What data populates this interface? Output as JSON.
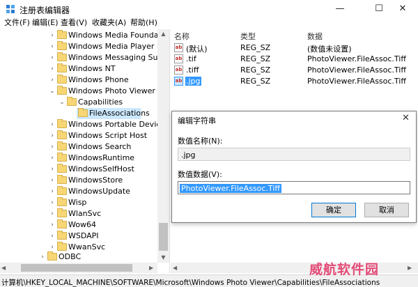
{
  "window": {
    "title": "注册表编辑器",
    "min": "—",
    "max": "☐",
    "close": "✕"
  },
  "menu": [
    "文件(F)",
    "编辑(E)",
    "查看(V)",
    "收藏夹(A)",
    "帮助(H)"
  ],
  "tree": [
    {
      "label": "Windows Media Foundation",
      "expanded": false
    },
    {
      "label": "Windows Media Player NSS",
      "expanded": false
    },
    {
      "label": "Windows Messaging Subsys",
      "expanded": false
    },
    {
      "label": "Windows NT",
      "expanded": false
    },
    {
      "label": "Windows Phone",
      "expanded": false
    },
    {
      "label": "Windows Photo Viewer",
      "expanded": true
    },
    {
      "label": "Capabilities",
      "expanded": true
    },
    {
      "label": "FileAssociations",
      "selected": true
    },
    {
      "label": "Windows Portable Devices",
      "expanded": false
    },
    {
      "label": "Windows Script Host",
      "expanded": false
    },
    {
      "label": "Windows Search",
      "expanded": false
    },
    {
      "label": "WindowsRuntime",
      "expanded": false
    },
    {
      "label": "WindowsSelfHost",
      "expanded": false
    },
    {
      "label": "WindowsStore",
      "expanded": false
    },
    {
      "label": "WindowsUpdate",
      "expanded": false
    },
    {
      "label": "Wisp",
      "expanded": false
    },
    {
      "label": "WlanSvc",
      "expanded": false
    },
    {
      "label": "Wow64",
      "expanded": false
    },
    {
      "label": "WSDAPI",
      "expanded": false
    },
    {
      "label": "WwanSvc",
      "expanded": false
    },
    {
      "label": "ODBC",
      "expanded": false
    }
  ],
  "list": {
    "headers": [
      "名称",
      "类型",
      "数据"
    ],
    "rows": [
      {
        "name": "(默认)",
        "type": "REG_SZ",
        "data": "(数值未设置)"
      },
      {
        "name": ".tif",
        "type": "REG_SZ",
        "data": "PhotoViewer.FileAssoc.Tiff"
      },
      {
        "name": ".tiff",
        "type": "REG_SZ",
        "data": "PhotoViewer.FileAssoc.Tiff"
      },
      {
        "name": ".jpg",
        "type": "REG_SZ",
        "data": "PhotoViewer.FileAssoc.Tiff"
      }
    ],
    "icon_text": "ab"
  },
  "dialog": {
    "title": "编辑字符串",
    "close": "✕",
    "name_label": "数值名称(N):",
    "name_value": ".jpg",
    "data_label": "数值数据(V):",
    "data_value": "PhotoViewer.FileAssoc.Tiff",
    "ok": "确定",
    "cancel": "取消"
  },
  "status": "计算机\\HKEY_LOCAL_MACHINE\\SOFTWARE\\Microsoft\\Windows Photo Viewer\\Capabilities\\FileAssociations",
  "watermark": "威航软件园",
  "colors": {
    "selection": "#3399ff",
    "tree_selection": "#cce8ff",
    "folder": "#f7d676",
    "watermark": "#e23a6b"
  }
}
